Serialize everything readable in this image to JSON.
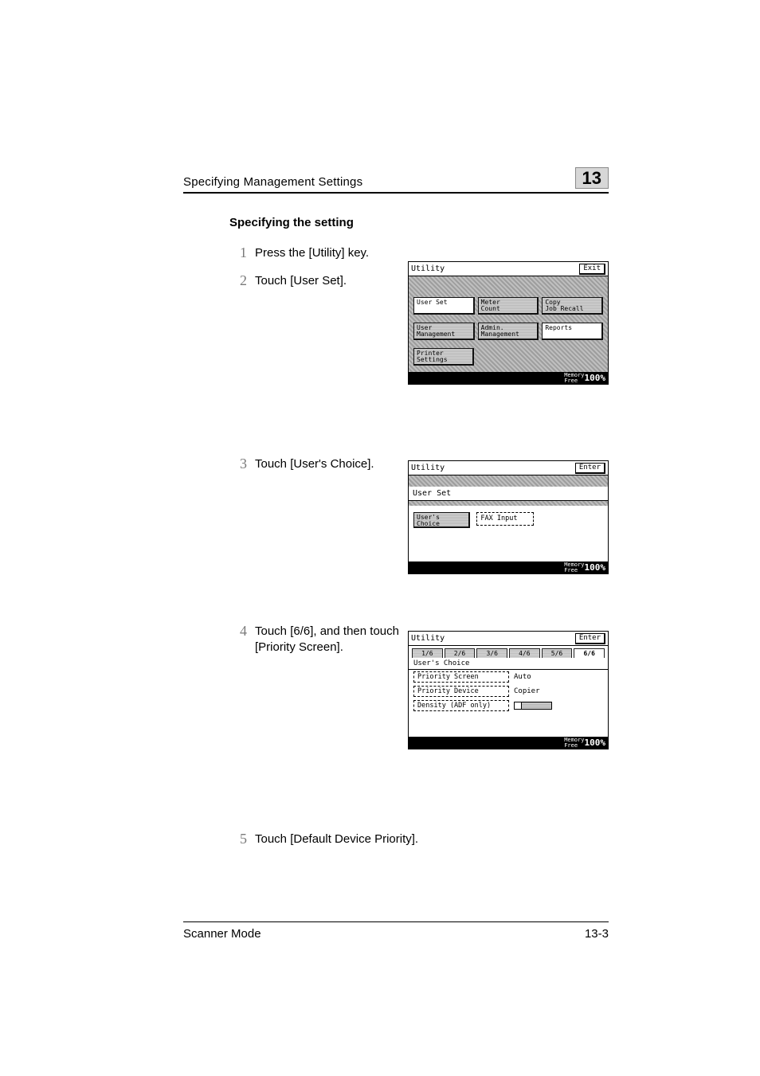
{
  "header": {
    "title": "Specifying Management Settings",
    "chapter": "13"
  },
  "section_heading": "Specifying the setting",
  "steps": {
    "s1": {
      "num": "1",
      "text": "Press the [Utility] key."
    },
    "s2": {
      "num": "2",
      "text": "Touch [User Set]."
    },
    "s3": {
      "num": "3",
      "text": "Touch [User's Choice]."
    },
    "s4": {
      "num": "4",
      "text": "Touch [6/6], and then touch [Priority Screen]."
    },
    "s5": {
      "num": "5",
      "text": "Touch [Default Device Priority]."
    }
  },
  "screen1": {
    "title": "Utility",
    "exit": "Exit",
    "buttons": {
      "user_set": "User Set",
      "meter_count": "Meter\nCount",
      "copy_job_recall": "Copy\nJob Recall",
      "user_management": "User\nManagement",
      "admin_management": "Admin.\nManagement",
      "reports": "Reports",
      "printer_settings": "Printer\nSettings"
    },
    "memory_label": "Memory\nFree",
    "memory_value": "100%"
  },
  "screen2": {
    "title": "Utility",
    "enter": "Enter",
    "sub": "User Set",
    "users_choice": "User's\nChoice",
    "fax_input": "FAX Input",
    "memory_label": "Memory\nFree",
    "memory_value": "100%"
  },
  "screen3": {
    "title": "Utility",
    "enter": "Enter",
    "tabs": [
      "1/6",
      "2/6",
      "3/6",
      "4/6",
      "5/6",
      "6/6"
    ],
    "sub": "User's Choice",
    "rows": {
      "priority_screen": {
        "label": "Priority Screen",
        "value": "Auto"
      },
      "priority_device": {
        "label": "Priority Device",
        "value": "Copier"
      },
      "density": {
        "label": "Density (ADF only)"
      }
    },
    "memory_label": "Memory\nFree",
    "memory_value": "100%"
  },
  "footer": {
    "mode": "Scanner Mode",
    "page": "13-3"
  }
}
